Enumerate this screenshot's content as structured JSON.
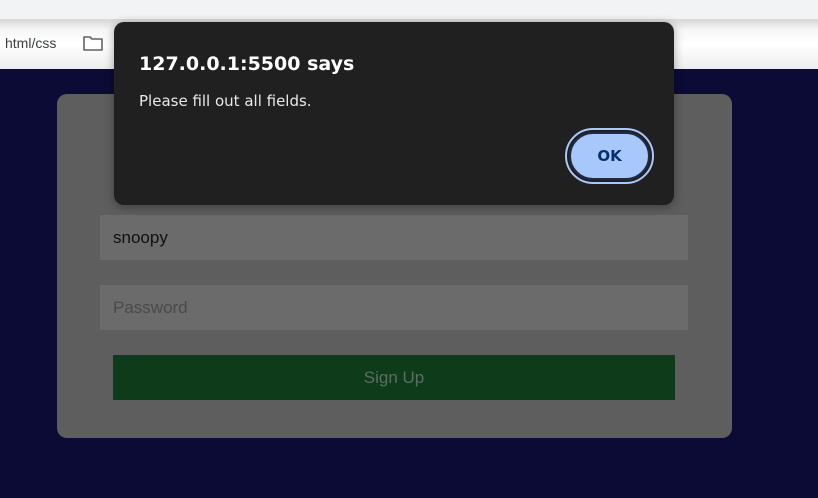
{
  "browser": {
    "bookmark_label": "html/css",
    "folder_icon": "folder-icon"
  },
  "form": {
    "username_value": "snoopy",
    "password_placeholder": "Password",
    "signup_label": "Sign Up"
  },
  "alert": {
    "title": "127.0.0.1:5500 says",
    "message": "Please fill out all fields.",
    "ok_label": "OK"
  },
  "colors": {
    "page_background": "#0b0b36",
    "card_background": "#5e5e5e",
    "signup_button": "#0e3b1a",
    "dialog_background": "#202020",
    "ok_button": "#a8c7fa"
  }
}
